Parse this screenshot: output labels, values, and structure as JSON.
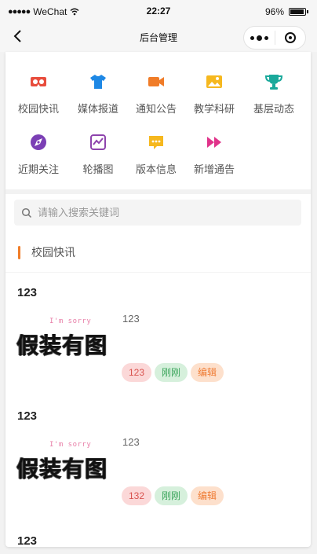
{
  "status_bar": {
    "carrier": "WeChat",
    "time": "22:27",
    "battery": "96%"
  },
  "nav": {
    "title": "后台管理"
  },
  "grid": [
    {
      "label": "校园快讯",
      "icon": "vr-glasses-icon",
      "color": "#e84d3d"
    },
    {
      "label": "媒体报道",
      "icon": "tshirt-icon",
      "color": "#1e88e5"
    },
    {
      "label": "通知公告",
      "icon": "video-camera-icon",
      "color": "#f07c28"
    },
    {
      "label": "教学科研",
      "icon": "picture-icon",
      "color": "#f6b81e"
    },
    {
      "label": "基层动态",
      "icon": "trophy-icon",
      "color": "#1aa99b"
    },
    {
      "label": "近期关注",
      "icon": "explore-icon",
      "color": "#7b3fb5"
    },
    {
      "label": "轮播图",
      "icon": "chart-frame-icon",
      "color": "#8e44ad"
    },
    {
      "label": "版本信息",
      "icon": "message-icon",
      "color": "#f6b81e"
    },
    {
      "label": "新增通告",
      "icon": "fast-forward-icon",
      "color": "#e0338a"
    }
  ],
  "search": {
    "placeholder": "请输入搜索关键词"
  },
  "section": {
    "title": "校园快讯"
  },
  "items": [
    {
      "title": "123",
      "image_small_text": "I'm sorry",
      "image_big_text": "假装有图",
      "content": "123",
      "tag_count": "123",
      "tag_time": "刚刚",
      "tag_edit": "编辑"
    },
    {
      "title": "123",
      "image_small_text": "I'm sorry",
      "image_big_text": "假装有图",
      "content": "123",
      "tag_count": "132",
      "tag_time": "刚刚",
      "tag_edit": "编辑"
    },
    {
      "title": "123"
    }
  ]
}
